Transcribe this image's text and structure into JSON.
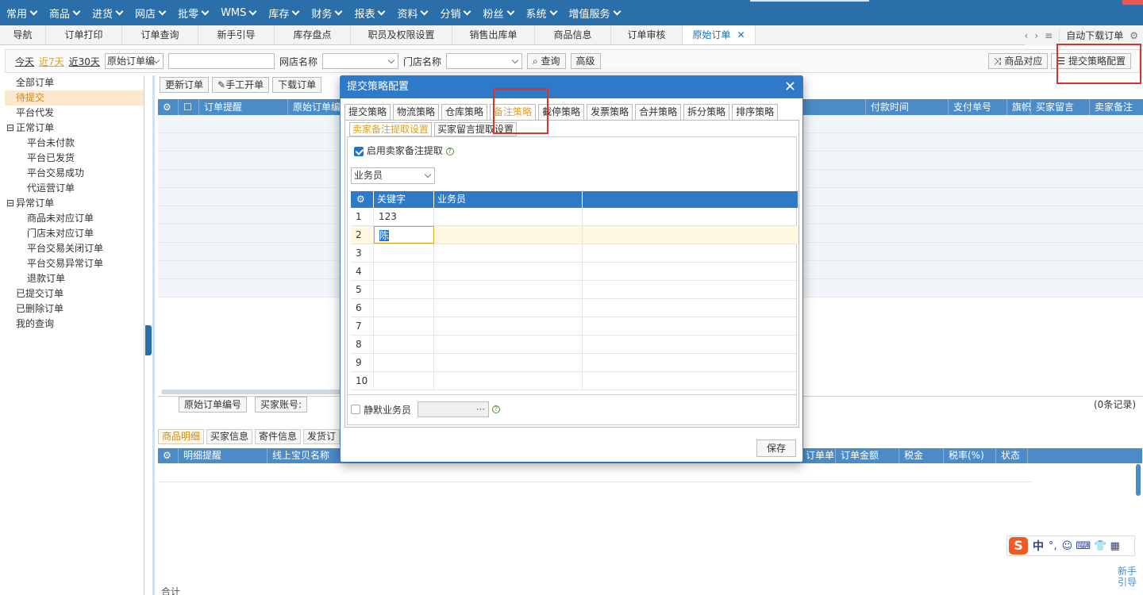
{
  "topmenu": [
    "常用",
    "商品",
    "进货",
    "网店",
    "批零",
    "WMS",
    "库存",
    "财务",
    "报表",
    "资料",
    "分销",
    "粉丝",
    "系统",
    "增值服务"
  ],
  "tabs": [
    {
      "label": "导航",
      "w": 58
    },
    {
      "label": "订单打印",
      "w": 96
    },
    {
      "label": "订单查询",
      "w": 96
    },
    {
      "label": "新手引导",
      "w": 96
    },
    {
      "label": "库存盘点",
      "w": 96
    },
    {
      "label": "职员及权限设置",
      "w": 128
    },
    {
      "label": "销售出库单",
      "w": 104
    },
    {
      "label": "商品信息",
      "w": 96
    },
    {
      "label": "订单审核",
      "w": 90
    }
  ],
  "active_tab": "原始订单",
  "tab_controls": {
    "prev": "‹",
    "next": "›",
    "menu": "≡",
    "auto_download": "自动下载订单",
    "gear": "⚙"
  },
  "filter": {
    "today": "今天",
    "last7": "近7天",
    "last30": "近30天",
    "order_type": "原始订单编",
    "shop_label": "网店名称",
    "store_label": "门店名称",
    "query": "查询",
    "advanced": "高级",
    "product_match": "商品对应",
    "submit_config": "提交策略配置"
  },
  "tree": [
    {
      "label": "全部订单",
      "indent": 0,
      "toggle": ""
    },
    {
      "label": "待提交",
      "indent": 0,
      "toggle": "",
      "selected": true
    },
    {
      "label": "平台代发",
      "indent": 0,
      "toggle": ""
    },
    {
      "label": "正常订单",
      "indent": 0,
      "toggle": "⊟"
    },
    {
      "label": "平台未付款",
      "indent": 2,
      "toggle": ""
    },
    {
      "label": "平台已发货",
      "indent": 2,
      "toggle": ""
    },
    {
      "label": "平台交易成功",
      "indent": 2,
      "toggle": ""
    },
    {
      "label": "代运营订单",
      "indent": 2,
      "toggle": ""
    },
    {
      "label": "异常订单",
      "indent": 0,
      "toggle": "⊟"
    },
    {
      "label": "商品未对应订单",
      "indent": 2,
      "toggle": ""
    },
    {
      "label": "门店未对应订单",
      "indent": 2,
      "toggle": ""
    },
    {
      "label": "平台交易关闭订单",
      "indent": 2,
      "toggle": ""
    },
    {
      "label": "平台交易异常订单",
      "indent": 2,
      "toggle": ""
    },
    {
      "label": "退款订单",
      "indent": 2,
      "toggle": ""
    },
    {
      "label": "已提交订单",
      "indent": 0,
      "toggle": ""
    },
    {
      "label": "已删除订单",
      "indent": 0,
      "toggle": ""
    },
    {
      "label": "我的查询",
      "indent": 0,
      "toggle": ""
    }
  ],
  "toolbar": {
    "refresh": "更新订单",
    "manual": "手工开单",
    "download": "下载订单"
  },
  "grid_cols": [
    {
      "label": "⚙",
      "w": 26
    },
    {
      "label": "☐",
      "w": 26
    },
    {
      "label": "订单提醒",
      "w": 112
    },
    {
      "label": "原始订单编",
      "w": 66
    },
    {
      "label": "",
      "w": 662
    },
    {
      "label": "付款时间",
      "w": 104
    },
    {
      "label": "支付单号",
      "w": 74
    },
    {
      "label": "旗帜",
      "w": 30
    },
    {
      "label": "买家留言",
      "w": 74
    },
    {
      "label": "卖家备注",
      "w": 70
    }
  ],
  "grid_foot": {
    "order_no": "原始订单编号",
    "buyer": "买家账号:",
    "records": "(0条记录)"
  },
  "detail_tabs": [
    "商品明细",
    "买家信息",
    "寄件信息",
    "发货订"
  ],
  "detail_cols": [
    {
      "label": "⚙",
      "w": 26
    },
    {
      "label": "明细提醒",
      "w": 112
    },
    {
      "label": "线上宝贝名称",
      "w": 672
    },
    {
      "label": "订单单",
      "w": 44
    },
    {
      "label": "订单金额",
      "w": 80
    },
    {
      "label": "税金",
      "w": 56
    },
    {
      "label": "税率(%)",
      "w": 66
    },
    {
      "label": "状态",
      "w": 40
    }
  ],
  "detail_total": "合计",
  "dialog": {
    "title": "提交策略配置",
    "close": "✕",
    "tabs": [
      "提交策略",
      "物流策略",
      "仓库策略",
      "备注策略",
      "截停策略",
      "发票策略",
      "合并策略",
      "拆分策略",
      "排序策略"
    ],
    "active_tab": "备注策略",
    "subtabs": [
      "卖家备注提取设置",
      "买家留言提取设置"
    ],
    "active_subtab": "卖家备注提取设置",
    "enable_label": "启用卖家备注提取",
    "help": "?",
    "field_select": "业务员",
    "table_head": {
      "gear": "⚙",
      "keyword": "关键字",
      "salesman": "业务员"
    },
    "rows": [
      {
        "n": "1",
        "keyword": "123",
        "salesman": ""
      },
      {
        "n": "2",
        "keyword": "陈",
        "salesman": ""
      },
      {
        "n": "3",
        "keyword": "",
        "salesman": ""
      },
      {
        "n": "4",
        "keyword": "",
        "salesman": ""
      },
      {
        "n": "5",
        "keyword": "",
        "salesman": ""
      },
      {
        "n": "6",
        "keyword": "",
        "salesman": ""
      },
      {
        "n": "7",
        "keyword": "",
        "salesman": ""
      },
      {
        "n": "8",
        "keyword": "",
        "salesman": ""
      },
      {
        "n": "9",
        "keyword": "",
        "salesman": ""
      },
      {
        "n": "10",
        "keyword": "",
        "salesman": ""
      }
    ],
    "default_label": "静默业务员",
    "dots": "···",
    "save": "保存"
  },
  "ime": {
    "logo": "S",
    "lang": "中",
    "punct": "°,",
    "icons": "☺ ⌨ 👕 ▦"
  },
  "newbie": "新手引导"
}
